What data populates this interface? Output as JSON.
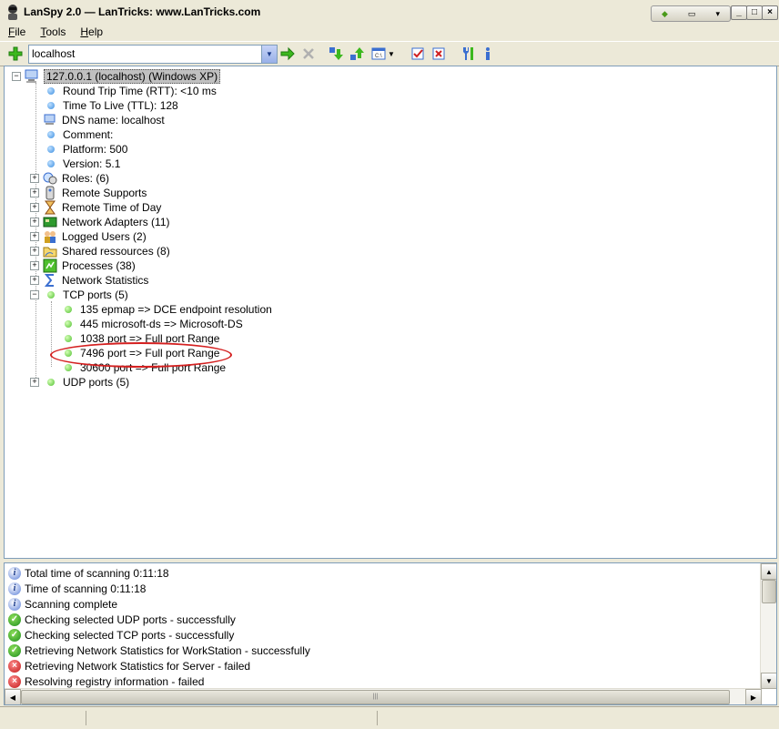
{
  "window": {
    "title": "LanSpy 2.0 — LanTricks: www.LanTricks.com"
  },
  "menu": {
    "items": [
      "File",
      "Tools",
      "Help"
    ]
  },
  "toolbar": {
    "address_value": "localhost",
    "icons": [
      "add-host-icon",
      "address-dropdown-icon",
      "go-icon",
      "stop-icon",
      "import-icon",
      "export-icon",
      "options-icon",
      "options-dropdown-icon",
      "select-all-icon",
      "deselect-all-icon",
      "tools-icon",
      "info-icon"
    ]
  },
  "tree": {
    "root": "127.0.0.1 (localhost) (Windows XP)",
    "props": [
      {
        "label": "Round Trip Time (RTT): <10 ms"
      },
      {
        "label": "Time To Live (TTL): 128"
      },
      {
        "label": "DNS name: localhost"
      },
      {
        "label": "Comment:"
      },
      {
        "label": "Platform: 500"
      },
      {
        "label": "Version: 5.1"
      }
    ],
    "groups": [
      {
        "label": "Roles: (6)"
      },
      {
        "label": "Remote Supports"
      },
      {
        "label": "Remote Time of Day"
      },
      {
        "label": "Network Adapters (11)"
      },
      {
        "label": "Logged Users (2)"
      },
      {
        "label": "Shared ressources (8)"
      },
      {
        "label": "Processes (38)"
      },
      {
        "label": "Network Statistics"
      },
      {
        "label": "TCP ports (5)"
      }
    ],
    "tcp_ports": [
      {
        "label": "135 epmap => DCE endpoint resolution"
      },
      {
        "label": "445 microsoft-ds => Microsoft-DS"
      },
      {
        "label": "1038 port => Full port Range"
      },
      {
        "label": "7496 port => Full port Range"
      },
      {
        "label": "30600 port => Full port Range"
      }
    ],
    "udp": "UDP ports (5)"
  },
  "log": [
    {
      "status": "info",
      "text": "Total time of scanning 0:11:18"
    },
    {
      "status": "info",
      "text": "Time of scanning 0:11:18"
    },
    {
      "status": "info",
      "text": "Scanning complete"
    },
    {
      "status": "ok",
      "text": "Checking selected UDP ports - successfully"
    },
    {
      "status": "ok",
      "text": "Checking selected TCP ports - successfully"
    },
    {
      "status": "ok",
      "text": "Retrieving Network Statistics for WorkStation - successfully"
    },
    {
      "status": "fail",
      "text": "Retrieving Network Statistics for Server - failed"
    },
    {
      "status": "fail",
      "text": "Resolving registry information - failed"
    }
  ],
  "colors": {
    "info": "#5b7fd8",
    "ok": "#1c8c1c",
    "fail": "#c01818",
    "highlight": "#d42020"
  }
}
